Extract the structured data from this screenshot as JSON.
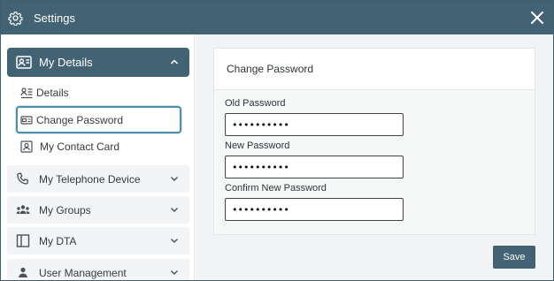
{
  "window": {
    "title": "Settings"
  },
  "sidebar": {
    "header": {
      "label": "My Details"
    },
    "sub_items": [
      {
        "label": "Details",
        "icon": "details-list-icon"
      },
      {
        "label": "Change Password",
        "icon": "password-card-icon",
        "active": true
      },
      {
        "label": "My Contact Card",
        "icon": "contact-card-icon"
      }
    ],
    "groups": [
      {
        "label": "My Telephone Device",
        "icon": "phone-icon"
      },
      {
        "label": "My Groups",
        "icon": "groups-icon"
      },
      {
        "label": "My DTA",
        "icon": "dta-icon"
      },
      {
        "label": "User Management",
        "icon": "user-management-icon"
      }
    ]
  },
  "panel": {
    "title": "Change Password",
    "fields": [
      {
        "label": "Old Password",
        "value": "••••••••••"
      },
      {
        "label": "New Password",
        "value": "••••••••••"
      },
      {
        "label": "Confirm New Password",
        "value": "••••••••••"
      }
    ],
    "save_label": "Save"
  },
  "colors": {
    "accent": "#436273",
    "active_border": "#4f8ea8",
    "content_bg": "#f2f3f4",
    "item_bg": "#f3f4f5"
  }
}
